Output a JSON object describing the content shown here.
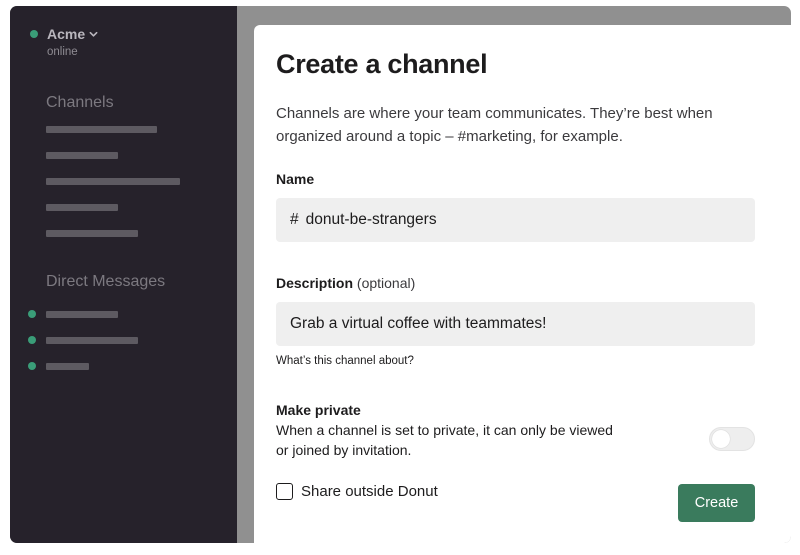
{
  "workspace": {
    "name": "Acme",
    "status": "online",
    "online_color": "#3a9d78"
  },
  "sidebar": {
    "channels_title": "Channels",
    "direct_messages_title": "Direct Messages",
    "background": "#26222b"
  },
  "modal": {
    "title": "Create a channel",
    "description": "Channels are where your team communicates. They’re best when organized around a topic – #marketing, for example.",
    "name_label": "Name",
    "name_prefix": "#",
    "name_value": "donut-be-strangers",
    "description_label": "Description",
    "description_optional": "(optional)",
    "description_value": "Grab a virtual coffee with teammates!",
    "description_hint": "What’s this channel about?",
    "private_title": "Make private",
    "private_text": "When a channel is set to private, it can only be viewed or joined by invitation.",
    "private_enabled": false,
    "share_label": "Share outside Donut",
    "share_checked": false,
    "create_label": "Create",
    "create_color": "#3a7b5d"
  }
}
